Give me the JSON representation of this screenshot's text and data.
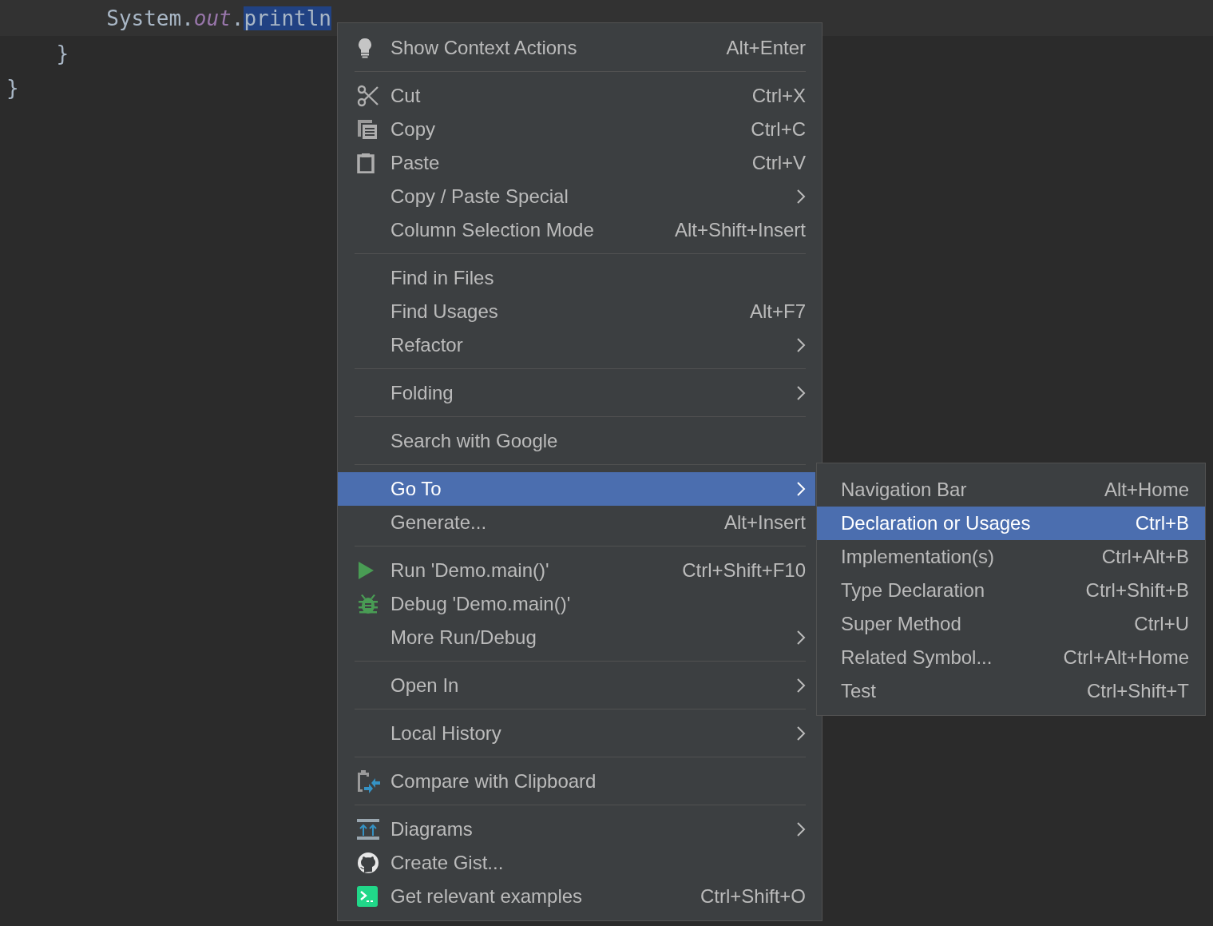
{
  "code": {
    "lines": [
      {
        "current": true,
        "tokens": [
          {
            "text": "        System.",
            "kind": "plain"
          },
          {
            "text": "out",
            "kind": "field"
          },
          {
            "text": ".",
            "kind": "plain"
          },
          {
            "text": "println",
            "kind": "selected"
          }
        ]
      },
      {
        "current": false,
        "tokens": [
          {
            "text": "    }",
            "kind": "plain"
          }
        ]
      },
      {
        "current": false,
        "tokens": [
          {
            "text": "}",
            "kind": "plain"
          }
        ]
      }
    ]
  },
  "context_menu": {
    "sections": [
      [
        {
          "label": "Show Context Actions",
          "shortcut": "Alt+Enter",
          "submenu": false,
          "selected": false
        }
      ],
      [
        {
          "label": "Cut",
          "shortcut": "Ctrl+X",
          "submenu": false,
          "selected": false
        },
        {
          "label": "Copy",
          "shortcut": "Ctrl+C",
          "submenu": false,
          "selected": false
        },
        {
          "label": "Paste",
          "shortcut": "Ctrl+V",
          "submenu": false,
          "selected": false
        },
        {
          "label": "Copy / Paste Special",
          "submenu": true,
          "selected": false
        },
        {
          "label": "Column Selection Mode",
          "shortcut": "Alt+Shift+Insert",
          "submenu": false,
          "selected": false
        }
      ],
      [
        {
          "label": "Find in Files",
          "submenu": false,
          "selected": false
        },
        {
          "label": "Find Usages",
          "shortcut": "Alt+F7",
          "submenu": false,
          "selected": false
        },
        {
          "label": "Refactor",
          "submenu": true,
          "selected": false
        }
      ],
      [
        {
          "label": "Folding",
          "submenu": true,
          "selected": false
        }
      ],
      [
        {
          "label": "Search with Google",
          "submenu": false,
          "selected": false
        }
      ],
      [
        {
          "label": "Go To",
          "submenu": true,
          "selected": true
        },
        {
          "label": "Generate...",
          "shortcut": "Alt+Insert",
          "submenu": false,
          "selected": false
        }
      ],
      [
        {
          "label": "Run 'Demo.main()'",
          "shortcut": "Ctrl+Shift+F10",
          "submenu": false,
          "selected": false
        },
        {
          "label": "Debug 'Demo.main()'",
          "submenu": false,
          "selected": false
        },
        {
          "label": "More Run/Debug",
          "submenu": true,
          "selected": false
        }
      ],
      [
        {
          "label": "Open In",
          "submenu": true,
          "selected": false
        }
      ],
      [
        {
          "label": "Local History",
          "submenu": true,
          "selected": false
        }
      ],
      [
        {
          "label": "Compare with Clipboard",
          "submenu": false,
          "selected": false
        }
      ],
      [
        {
          "label": "Diagrams",
          "submenu": true,
          "selected": false
        },
        {
          "label": "Create Gist...",
          "submenu": false,
          "selected": false
        },
        {
          "label": "Get relevant examples",
          "shortcut": "Ctrl+Shift+O",
          "submenu": false,
          "selected": false
        }
      ]
    ]
  },
  "submenu": {
    "items": [
      {
        "label": "Navigation Bar",
        "shortcut": "Alt+Home",
        "selected": false
      },
      {
        "label": "Declaration or Usages",
        "shortcut": "Ctrl+B",
        "selected": true
      },
      {
        "label": "Implementation(s)",
        "shortcut": "Ctrl+Alt+B",
        "selected": false
      },
      {
        "label": "Type Declaration",
        "shortcut": "Ctrl+Shift+B",
        "selected": false
      },
      {
        "label": "Super Method",
        "shortcut": "Ctrl+U",
        "selected": false
      },
      {
        "label": "Related Symbol...",
        "shortcut": "Ctrl+Alt+Home",
        "selected": false
      },
      {
        "label": "Test",
        "shortcut": "Ctrl+Shift+T",
        "selected": false
      }
    ]
  }
}
